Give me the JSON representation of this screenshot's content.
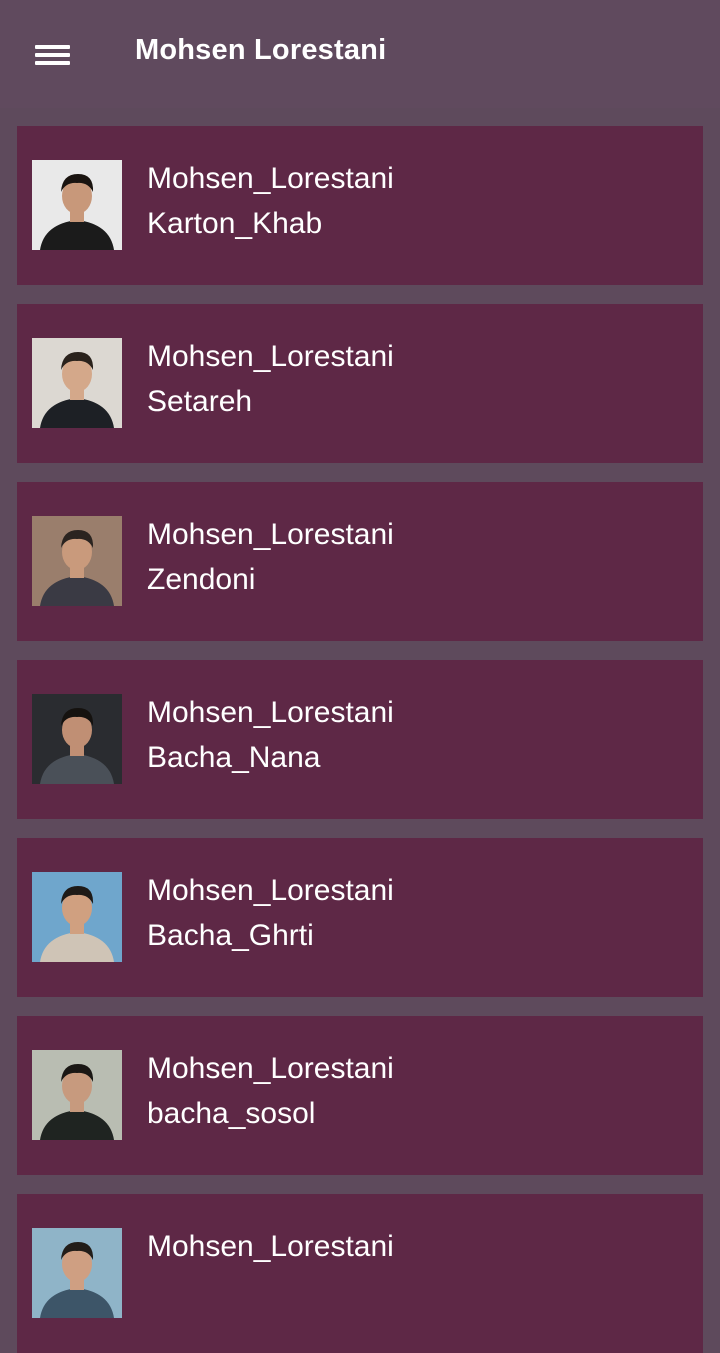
{
  "app_bar": {
    "title": "Mohsen Lorestani",
    "menu_icon": "hamburger-menu-icon"
  },
  "colors": {
    "app_bar_bg": "#604a5e",
    "page_bg": "#5e4a5c",
    "card_bg": "#5e2846",
    "text": "#ffffff"
  },
  "songs": [
    {
      "artist": "Mohsen_Lorestani",
      "title": "Karton_Khab",
      "thumb": {
        "bg": "#e9e9e9",
        "shirt": "#1b1b1b",
        "hair": "#1a1410",
        "skin": "#c8987a"
      }
    },
    {
      "artist": "Mohsen_Lorestani",
      "title": "Setareh",
      "thumb": {
        "bg": "#dcd8d2",
        "shirt": "#1d2025",
        "hair": "#2a221c",
        "skin": "#d4a88a"
      }
    },
    {
      "artist": "Mohsen_Lorestani",
      "title": "Zendoni",
      "thumb": {
        "bg": "#9a7e6c",
        "shirt": "#3a3a44",
        "hair": "#2b2420",
        "skin": "#c99a7c"
      }
    },
    {
      "artist": "Mohsen_Lorestani",
      "title": "Bacha_Nana",
      "thumb": {
        "bg": "#2a2c30",
        "shirt": "#4a5058",
        "hair": "#15120f",
        "skin": "#c08f74"
      }
    },
    {
      "artist": "Mohsen_Lorestani",
      "title": "Bacha_Ghrti",
      "thumb": {
        "bg": "#6fa6cc",
        "shirt": "#cfc4b6",
        "hair": "#1e1a17",
        "skin": "#d0a080"
      }
    },
    {
      "artist": "Mohsen_Lorestani",
      "title": "bacha_sosol",
      "thumb": {
        "bg": "#b9bdb2",
        "shirt": "#1f2421",
        "hair": "#1a1714",
        "skin": "#c79a7e"
      }
    },
    {
      "artist": "Mohsen_Lorestani",
      "title": "",
      "thumb": {
        "bg": "#8fb4c8",
        "shirt": "#3d5568",
        "hair": "#221d19",
        "skin": "#cf9f82"
      }
    }
  ]
}
